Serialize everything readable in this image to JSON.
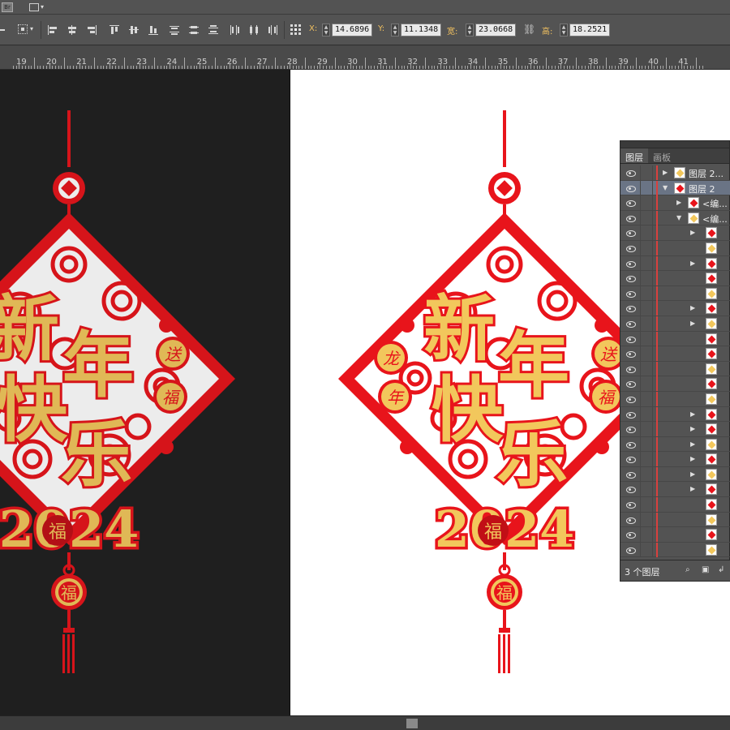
{
  "app": {
    "bridge_badge": "Br"
  },
  "toolbar": {
    "x_label": "X:",
    "x_value": "14.6896",
    "y_label": "Y:",
    "y_value": "11.1348",
    "w_label": "宽:",
    "w_value": "23.0668",
    "h_label": "高:",
    "h_value": "18.2521"
  },
  "ruler": {
    "labels": [
      "19",
      "20",
      "21",
      "22",
      "23",
      "24",
      "25",
      "26",
      "27",
      "28",
      "29",
      "30",
      "31",
      "32",
      "33",
      "34",
      "35",
      "36",
      "37",
      "38",
      "39",
      "40",
      "41"
    ]
  },
  "artwork": {
    "title_chars": [
      "新",
      "年",
      "快",
      "乐"
    ],
    "year": "2024",
    "left_medallions": [
      "龙",
      "年"
    ],
    "right_medallions": [
      "送",
      "福"
    ],
    "fortune_char": "福",
    "colors": {
      "red": "#e8141b",
      "gold": "#f2c75c",
      "dark_red": "#c10f16"
    }
  },
  "layers_panel": {
    "tabs": [
      "图层",
      "画板"
    ],
    "rows": [
      {
        "name": "图层 2...",
        "expanded": false,
        "indent": 0,
        "selected": false
      },
      {
        "name": "图层 2",
        "expanded": true,
        "indent": 0,
        "selected": true
      },
      {
        "name": "<编...",
        "expanded": false,
        "indent": 1,
        "selected": false
      },
      {
        "name": "<编...",
        "expanded": true,
        "indent": 1,
        "selected": false
      },
      {
        "name": "",
        "expanded": false,
        "indent": 2,
        "selected": false
      },
      {
        "name": "",
        "expanded": null,
        "indent": 2,
        "selected": false
      },
      {
        "name": "",
        "expanded": false,
        "indent": 2,
        "selected": false
      },
      {
        "name": "",
        "expanded": null,
        "indent": 2,
        "selected": false
      },
      {
        "name": "",
        "expanded": null,
        "indent": 2,
        "selected": false
      },
      {
        "name": "",
        "expanded": false,
        "indent": 2,
        "selected": false
      },
      {
        "name": "",
        "expanded": false,
        "indent": 2,
        "selected": false
      },
      {
        "name": "",
        "expanded": null,
        "indent": 2,
        "selected": false
      },
      {
        "name": "",
        "expanded": null,
        "indent": 2,
        "selected": false
      },
      {
        "name": "",
        "expanded": null,
        "indent": 2,
        "selected": false
      },
      {
        "name": "",
        "expanded": null,
        "indent": 2,
        "selected": false
      },
      {
        "name": "",
        "expanded": null,
        "indent": 2,
        "selected": false
      },
      {
        "name": "",
        "expanded": false,
        "indent": 2,
        "selected": false
      },
      {
        "name": "",
        "expanded": false,
        "indent": 2,
        "selected": false
      },
      {
        "name": "",
        "expanded": false,
        "indent": 2,
        "selected": false
      },
      {
        "name": "",
        "expanded": false,
        "indent": 2,
        "selected": false
      },
      {
        "name": "",
        "expanded": false,
        "indent": 2,
        "selected": false
      },
      {
        "name": "",
        "expanded": false,
        "indent": 2,
        "selected": false
      },
      {
        "name": "",
        "expanded": null,
        "indent": 2,
        "selected": false
      },
      {
        "name": "",
        "expanded": null,
        "indent": 2,
        "selected": false
      },
      {
        "name": "",
        "expanded": null,
        "indent": 2,
        "selected": false
      },
      {
        "name": "",
        "expanded": null,
        "indent": 2,
        "selected": false
      }
    ],
    "footer_count": "3 个图层"
  }
}
